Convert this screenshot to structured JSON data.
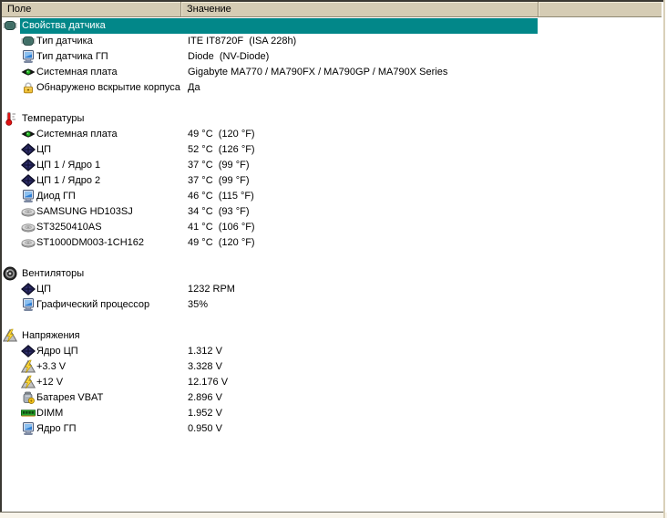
{
  "colors": {
    "selection_bg": "#028789",
    "header_bg": "#d5ccb4",
    "header_border": "#9a927c"
  },
  "columns": [
    {
      "label": "Поле"
    },
    {
      "label": "Значение"
    }
  ],
  "rows": [
    {
      "type": "section-selected",
      "icon": "chip-icon",
      "label": "Свойства датчика",
      "value": ""
    },
    {
      "type": "item",
      "icon": "chip-icon",
      "label": "Тип датчика",
      "value": "ITE IT8720F  (ISA 228h)"
    },
    {
      "type": "item",
      "icon": "gpu-icon",
      "label": "Тип датчика ГП",
      "value": "Diode  (NV-Diode)"
    },
    {
      "type": "item",
      "icon": "motherboard-icon",
      "label": "Системная плата",
      "value": "Gigabyte MA770 / MA790FX / MA790GP / MA790X Series"
    },
    {
      "type": "item",
      "icon": "lock-icon",
      "label": "Обнаружено вскрытие корпуса",
      "value": "Да"
    },
    {
      "type": "spacer"
    },
    {
      "type": "section",
      "icon": "thermometer-icon",
      "label": "Температуры",
      "value": ""
    },
    {
      "type": "item",
      "icon": "motherboard-icon",
      "label": "Системная плата",
      "value": "49 °C  (120 °F)"
    },
    {
      "type": "item",
      "icon": "cpu-icon",
      "label": "ЦП",
      "value": "52 °C  (126 °F)"
    },
    {
      "type": "item",
      "icon": "cpu-icon",
      "label": "ЦП 1 / Ядро 1",
      "value": "37 °C  (99 °F)"
    },
    {
      "type": "item",
      "icon": "cpu-icon",
      "label": "ЦП 1 / Ядро 2",
      "value": "37 °C  (99 °F)"
    },
    {
      "type": "item",
      "icon": "gpu-icon",
      "label": "Диод ГП",
      "value": "46 °C  (115 °F)"
    },
    {
      "type": "item",
      "icon": "hdd-icon",
      "label": "SAMSUNG HD103SJ",
      "value": "34 °C  (93 °F)"
    },
    {
      "type": "item",
      "icon": "hdd-icon",
      "label": "ST3250410AS",
      "value": "41 °C  (106 °F)"
    },
    {
      "type": "item",
      "icon": "hdd-icon",
      "label": "ST1000DM003-1CH162",
      "value": "49 °C  (120 °F)"
    },
    {
      "type": "spacer"
    },
    {
      "type": "section",
      "icon": "fan-icon",
      "label": "Вентиляторы",
      "value": ""
    },
    {
      "type": "item",
      "icon": "cpu-icon",
      "label": "ЦП",
      "value": "1232 RPM"
    },
    {
      "type": "item",
      "icon": "gpu-icon",
      "label": "Графический процессор",
      "value": "35%"
    },
    {
      "type": "spacer"
    },
    {
      "type": "section",
      "icon": "voltage-icon",
      "label": "Напряжения",
      "value": ""
    },
    {
      "type": "item",
      "icon": "cpu-icon",
      "label": "Ядро ЦП",
      "value": "1.312 V"
    },
    {
      "type": "item",
      "icon": "voltage-icon",
      "label": "+3.3 V",
      "value": "3.328 V"
    },
    {
      "type": "item",
      "icon": "voltage-icon",
      "label": "+12 V",
      "value": "12.176 V"
    },
    {
      "type": "item",
      "icon": "battery-icon",
      "label": "Батарея VBAT",
      "value": "2.896 V"
    },
    {
      "type": "item",
      "icon": "dimm-icon",
      "label": "DIMM",
      "value": "1.952 V"
    },
    {
      "type": "item",
      "icon": "gpu-icon",
      "label": "Ядро ГП",
      "value": "0.950 V"
    }
  ]
}
